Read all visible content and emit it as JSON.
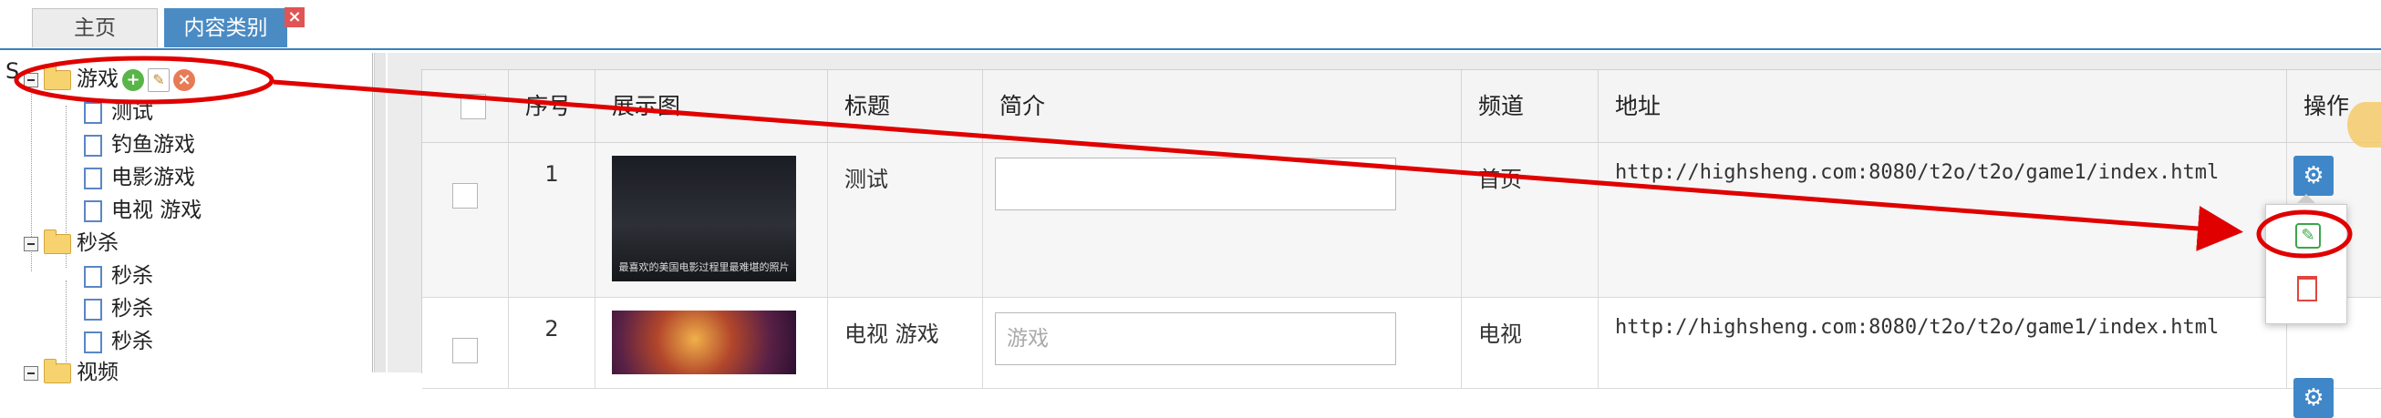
{
  "tabs": [
    {
      "label": "主页"
    },
    {
      "label": "内容类别"
    }
  ],
  "tab_close_glyph": "×",
  "tree": {
    "root_letter": "S",
    "nodes": [
      {
        "label": "游戏",
        "children": [
          "测试",
          "钓鱼游戏",
          "电影游戏",
          "电视 游戏"
        ]
      },
      {
        "label": "秒杀",
        "children": [
          "秒杀",
          "秒杀",
          "秒杀"
        ]
      },
      {
        "label": "视频"
      }
    ]
  },
  "table": {
    "headers": [
      "序号",
      "展示图",
      "标题",
      "简介",
      "频道",
      "地址",
      "操作"
    ],
    "rows": [
      {
        "index": "1",
        "thumb_caption": "最喜欢的美国电影过程里最难堪的照片",
        "title": "测试",
        "intro": "",
        "channel": "首页",
        "address": "http://highsheng.com:8080/t2o/t2o/game1/index.html"
      },
      {
        "index": "2",
        "thumb_caption": "",
        "title": "电视 游戏",
        "intro": "游戏",
        "channel": "电视",
        "address": "http://highsheng.com:8080/t2o/t2o/game1/index.html"
      }
    ]
  },
  "icons": {
    "gear": "gear-icon",
    "edit": "edit-icon",
    "trash": "trash-icon",
    "add": "add-icon",
    "delete": "delete-icon"
  },
  "colors": {
    "tab_active": "#4a8bc4",
    "primary_button": "#3f87c8",
    "annotation": "#e00000",
    "edit_green": "#3aa64a",
    "delete_red": "#e0463c"
  }
}
